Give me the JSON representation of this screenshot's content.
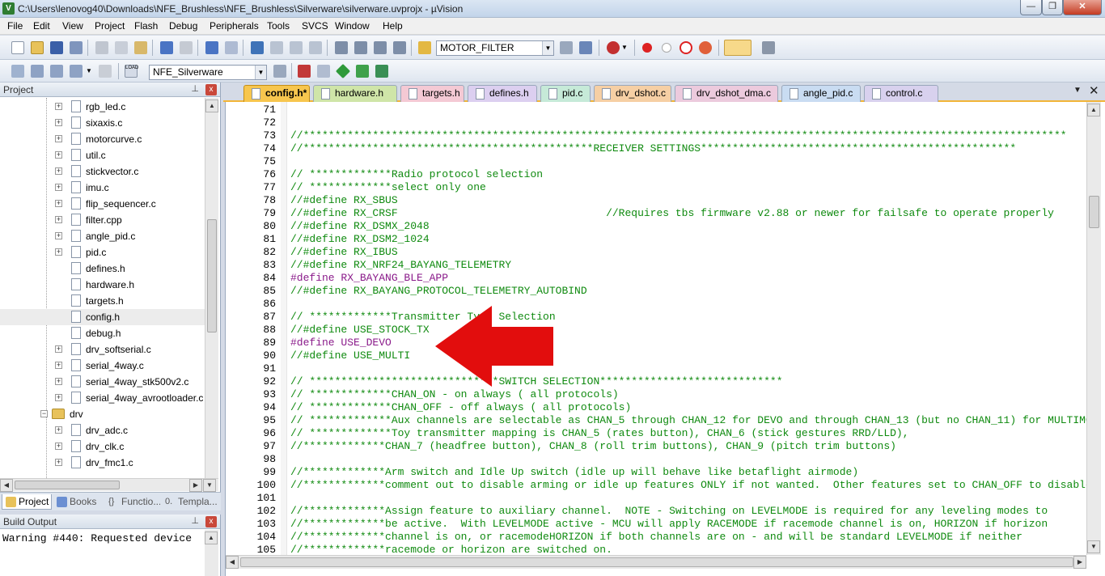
{
  "window": {
    "title": "C:\\Users\\lenovog40\\Downloads\\NFE_Brushless\\NFE_Brushless\\Silverware\\silverware.uvprojx - µVision",
    "app_icon": "V",
    "min_label": "—",
    "max_label": "❐",
    "close_label": "✕"
  },
  "menu": [
    "File",
    "Edit",
    "View",
    "Project",
    "Flash",
    "Debug",
    "Peripherals",
    "Tools",
    "SVCS",
    "Window",
    "Help"
  ],
  "toolbar": {
    "find_combo_value": "MOTOR_FILTER",
    "target_combo_value": "NFE_Silverware"
  },
  "project_panel": {
    "title": "Project",
    "pin_icon": "pin-icon",
    "close_label": "x",
    "tree": [
      {
        "label": "rgb_led.c",
        "type": "file",
        "expandable": true
      },
      {
        "label": "sixaxis.c",
        "type": "file",
        "expandable": true
      },
      {
        "label": "motorcurve.c",
        "type": "file",
        "expandable": true
      },
      {
        "label": "util.c",
        "type": "file",
        "expandable": true
      },
      {
        "label": "stickvector.c",
        "type": "file",
        "expandable": true
      },
      {
        "label": "imu.c",
        "type": "file",
        "expandable": true
      },
      {
        "label": "flip_sequencer.c",
        "type": "file",
        "expandable": true
      },
      {
        "label": "filter.cpp",
        "type": "file",
        "expandable": true
      },
      {
        "label": "angle_pid.c",
        "type": "file",
        "expandable": true
      },
      {
        "label": "pid.c",
        "type": "file",
        "expandable": true
      },
      {
        "label": "defines.h",
        "type": "file",
        "expandable": false
      },
      {
        "label": "hardware.h",
        "type": "file",
        "expandable": false
      },
      {
        "label": "targets.h",
        "type": "file",
        "expandable": false
      },
      {
        "label": "config.h",
        "type": "file",
        "expandable": false,
        "selected": true
      },
      {
        "label": "debug.h",
        "type": "file",
        "expandable": false
      },
      {
        "label": "drv_softserial.c",
        "type": "file",
        "expandable": true
      },
      {
        "label": "serial_4way.c",
        "type": "file",
        "expandable": true
      },
      {
        "label": "serial_4way_stk500v2.c",
        "type": "file",
        "expandable": true
      },
      {
        "label": "serial_4way_avrootloader.c",
        "type": "file",
        "expandable": true
      },
      {
        "label": "drv",
        "type": "folder",
        "expandable": true
      },
      {
        "label": "drv_adc.c",
        "type": "file",
        "expandable": true
      },
      {
        "label": "drv_clk.c",
        "type": "file",
        "expandable": true
      },
      {
        "label": "drv_fmc1.c",
        "type": "file",
        "expandable": true
      }
    ],
    "tabs": [
      "Project",
      "Books",
      "Functio...",
      "Templa..."
    ]
  },
  "build_output": {
    "title": "Build Output",
    "text": "Warning #440: Requested device"
  },
  "editor_tabs": [
    {
      "label": "config.h*",
      "color": "#f7c64e",
      "active": true
    },
    {
      "label": "hardware.h",
      "color": "#cfe5a8"
    },
    {
      "label": "targets.h",
      "color": "#f4c9d4"
    },
    {
      "label": "defines.h",
      "color": "#dccff0"
    },
    {
      "label": "pid.c",
      "color": "#c6ead8"
    },
    {
      "label": "drv_dshot.c",
      "color": "#f6cfa4"
    },
    {
      "label": "drv_dshot_dma.c",
      "color": "#eccadd"
    },
    {
      "label": "angle_pid.c",
      "color": "#c9dcf2"
    },
    {
      "label": "control.c",
      "color": "#d8d1ee"
    }
  ],
  "code_lines": [
    {
      "n": "71",
      "t": "",
      "k": "plain"
    },
    {
      "n": "72",
      "t": "",
      "k": "plain"
    },
    {
      "n": "73",
      "t": "//*************************************************************************************************************************",
      "k": "comment"
    },
    {
      "n": "74",
      "t": "//**********************************************RECEIVER SETTINGS**************************************************",
      "k": "comment"
    },
    {
      "n": "75",
      "t": "",
      "k": "plain"
    },
    {
      "n": "76",
      "t": "// *************Radio protocol selection",
      "k": "comment"
    },
    {
      "n": "77",
      "t": "// *************select only one",
      "k": "comment"
    },
    {
      "n": "78",
      "t": "//#define RX_SBUS",
      "k": "comment"
    },
    {
      "n": "79",
      "t": "//#define RX_CRSF                                 //Requires tbs firmware v2.88 or newer for failsafe to operate properly",
      "k": "comment"
    },
    {
      "n": "80",
      "t": "//#define RX_DSMX_2048",
      "k": "comment"
    },
    {
      "n": "81",
      "t": "//#define RX_DSM2_1024",
      "k": "comment"
    },
    {
      "n": "82",
      "t": "//#define RX_IBUS",
      "k": "comment"
    },
    {
      "n": "83",
      "t": "//#define RX_NRF24_BAYANG_TELEMETRY",
      "k": "comment"
    },
    {
      "n": "84",
      "t": "#define RX_BAYANG_BLE_APP",
      "k": "directive"
    },
    {
      "n": "85",
      "t": "//#define RX_BAYANG_PROTOCOL_TELEMETRY_AUTOBIND",
      "k": "comment"
    },
    {
      "n": "86",
      "t": "",
      "k": "plain"
    },
    {
      "n": "87",
      "t": "// *************Transmitter Type Selection",
      "k": "comment"
    },
    {
      "n": "88",
      "t": "//#define USE_STOCK_TX",
      "k": "comment"
    },
    {
      "n": "89",
      "t": "#define USE_DEVO",
      "k": "directive"
    },
    {
      "n": "90",
      "t": "//#define USE_MULTI",
      "k": "comment"
    },
    {
      "n": "91",
      "t": "",
      "k": "plain"
    },
    {
      "n": "92",
      "t": "// ******************************SWITCH SELECTION*****************************",
      "k": "comment"
    },
    {
      "n": "93",
      "t": "// *************CHAN_ON - on always ( all protocols)",
      "k": "comment"
    },
    {
      "n": "94",
      "t": "// *************CHAN_OFF - off always ( all protocols)",
      "k": "comment"
    },
    {
      "n": "95",
      "t": "// *************Aux channels are selectable as CHAN_5 through CHAN_12 for DEVO and through CHAN_13 (but no CHAN_11) for MULTIMODULE users",
      "k": "comment"
    },
    {
      "n": "96",
      "t": "// *************Toy transmitter mapping is CHAN_5 (rates button), CHAN_6 (stick gestures RRD/LLD),",
      "k": "comment"
    },
    {
      "n": "97",
      "t": "//*************CHAN_7 (headfree button), CHAN_8 (roll trim buttons), CHAN_9 (pitch trim buttons)",
      "k": "comment"
    },
    {
      "n": "98",
      "t": "",
      "k": "plain"
    },
    {
      "n": "99",
      "t": "//*************Arm switch and Idle Up switch (idle up will behave like betaflight airmode)",
      "k": "comment"
    },
    {
      "n": "100",
      "t": "//*************comment out to disable arming or idle up features ONLY if not wanted.  Other features set to CHAN_OFF to disable",
      "k": "comment"
    },
    {
      "n": "101",
      "t": "",
      "k": "plain"
    },
    {
      "n": "102",
      "t": "//*************Assign feature to auxiliary channel.  NOTE - Switching on LEVELMODE is required for any leveling modes to",
      "k": "comment"
    },
    {
      "n": "103",
      "t": "//*************be active.  With LEVELMODE active - MCU will apply RACEMODE if racemode channel is on, HORIZON if horizon",
      "k": "comment"
    },
    {
      "n": "104",
      "t": "//*************channel is on, or racemodeHORIZON if both channels are on - and will be standard LEVELMODE if neither",
      "k": "comment"
    },
    {
      "n": "105",
      "t": "//*************racemode or horizon are switched on.",
      "k": "comment"
    }
  ],
  "colors": {
    "comment": "#0f8a0f",
    "directive": "#8a1a8a",
    "active_tab": "#f7c64e",
    "arrow": "#e20d0d"
  }
}
